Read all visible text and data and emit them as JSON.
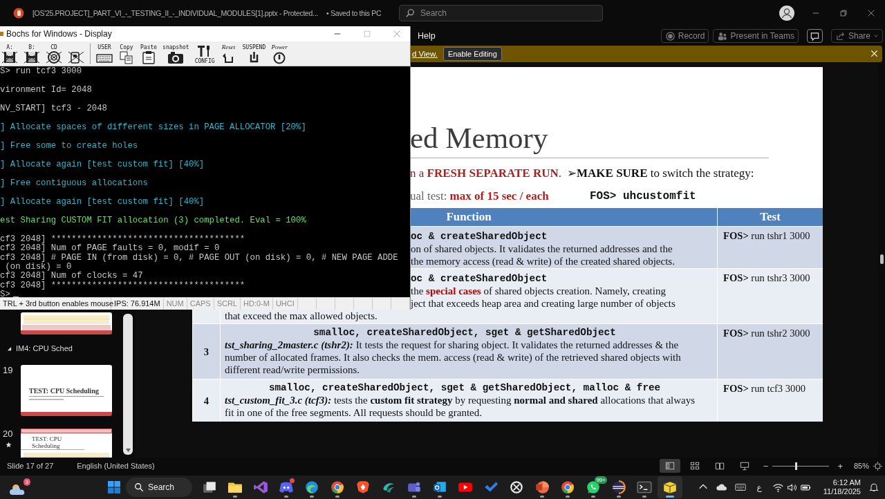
{
  "app_window": {
    "title": "[OS'25.PROJECT]_PART_VI_-_TESTING_II_-_INDIVIDUAL_MODULES[1].pptx  -  Protected...",
    "save_status": "• Saved to this PC",
    "search": {
      "placeholder": "Search"
    }
  },
  "ribbon": {
    "tabs": [
      {
        "label": "Help",
        "selected": false
      }
    ],
    "buttons": [
      {
        "kind": "record",
        "label": "Record"
      },
      {
        "kind": "teams",
        "label": "Present in Teams"
      },
      {
        "kind": "comments"
      },
      {
        "kind": "share",
        "label": "Share"
      }
    ]
  },
  "message_bar": {
    "link": "d View.",
    "button": "Enable Editing"
  },
  "thumbnails": [
    {
      "kind": "table_slide"
    },
    {
      "kind": "section",
      "label": "IM4: CPU Sched",
      "expanded": true
    },
    {
      "kind": "title_slide",
      "number": "19",
      "title": "TEST: CPU Scheduling",
      "animated": false
    },
    {
      "kind": "table_slide",
      "number": "20",
      "title": "TEST: CPU Scheduling",
      "animated": true
    }
  ],
  "slide": {
    "title": "ed Memory",
    "notes": [
      {
        "kind": "warning",
        "text": "n a **FRESH SEPARATE RUN**."
      },
      {
        "kind": "plain",
        "text": "➢**MAKE SURE** to switch the strategy:"
      },
      {
        "kind": "limit",
        "text": "ual test: **max of 15 sec / each**"
      },
      {
        "kind": "command",
        "text": "FOS> uhcustomfit"
      }
    ],
    "table": {
      "columns": [
        "Function",
        "Test"
      ],
      "rows": [
        {
          "kind": "partial",
          "function": "oc & createSharedObject",
          "lines": [
            {
              "text": "on of shared objects. It validates the returned addresses and the",
              "cut": true
            },
            {
              "text": "the memory access (read & write) of the created shared objects.",
              "cut": true
            }
          ],
          "test": "**FOS>** run tshr1 3000"
        },
        {
          "kind": "partial",
          "function": "oc & createSharedObject",
          "lines": [
            {
              "text": "the **special cases** of shared objects creation. Namely, creating",
              "cut": true
            },
            {
              "text": "ject that exceeds heap area and creating large number of objects",
              "cut": true
            },
            {
              "text": "that exceed the max allowed objects.",
              "cut": false
            }
          ],
          "test": "**FOS>** run tshr3 3000"
        },
        {
          "kind": "full",
          "number": "3",
          "function": "smalloc, createSharedObject, sget & getSharedObject",
          "file": "tst_sharing_2master.c (tshr2):",
          "text": "It tests the request for sharing object. It validates the returned addresses & the number of allocated frames. It also checks the mem. access (read & write) of the retrieved shared objects with different read/write permissions.",
          "test": "**FOS>** run tshr2 3000"
        },
        {
          "kind": "full",
          "number": "4",
          "function": "smalloc, createSharedObject, sget & getSharedObject, malloc & free",
          "file": "tst_custom_fit_3.c (tcf3):",
          "text": "tests the **custom fit strategy** by requesting **normal and shared** allocations that always fit in one of the free segments. All requests should be granted.",
          "test": "**FOS>** run tcf3 3000"
        }
      ]
    }
  },
  "status_bar": {
    "slide": "Slide 17 of 27",
    "language": "English (United States)",
    "views": [
      {
        "kind": "normal",
        "selected": true
      },
      {
        "kind": "sorter",
        "selected": false
      },
      {
        "kind": "reading",
        "selected": false
      },
      {
        "kind": "show",
        "selected": false
      }
    ],
    "zoom": {
      "minus": "−",
      "plus": "+",
      "level": 0.41,
      "reading": "85%"
    }
  },
  "bochs_window": {
    "title": "Bochs for Windows - Display",
    "toolbar": [
      {
        "kind": "floppy",
        "label": "A:",
        "disabled": true
      },
      {
        "kind": "floppy",
        "label": "B:",
        "disabled": true
      },
      {
        "kind": "cdrom",
        "label": "CD",
        "disabled": true
      },
      {
        "kind": "harddisk",
        "disabled": true
      },
      {
        "kind": "user",
        "label": "USER",
        "disabled": false
      },
      {
        "kind": "copy",
        "label": "Copy",
        "disabled": false
      },
      {
        "kind": "paste",
        "label": "Paste",
        "disabled": false
      },
      {
        "kind": "snapshot",
        "label": "snapshot",
        "disabled": false
      },
      {
        "kind": "config",
        "label": "CONFIG",
        "disabled": false
      },
      {
        "kind": "reset",
        "label": "Reset",
        "disabled": false
      },
      {
        "kind": "suspend",
        "label": "SUSPEND",
        "disabled": false
      },
      {
        "kind": "power",
        "label": "Power",
        "disabled": false
      }
    ],
    "console": [
      {
        "kind": "info",
        "text": "S> run tcf3 3000"
      },
      {
        "kind": "info",
        "text": "vironment Id= 2048"
      },
      {
        "kind": "info",
        "text": "NV_START] tcf3 - 2048"
      },
      {
        "kind": "step",
        "text": "] Allocate spaces of different sizes in PAGE ALLOCATOR [20%]"
      },
      {
        "kind": "step",
        "text": "] Free some to create holes"
      },
      {
        "kind": "step",
        "text": "] Allocate again [test custom fit] [40%]"
      },
      {
        "kind": "step",
        "text": "] Free contiguous allocations"
      },
      {
        "kind": "step",
        "text": "] Allocate again [test custom fit] [40%]"
      },
      {
        "kind": "result",
        "text": "est Sharing CUSTOM FIT allocation (3) completed. Eval = 100%"
      },
      {
        "kind": "log",
        "text": "cf3 2048] **************************************"
      },
      {
        "kind": "log",
        "text": "cf3 2048] Num of PAGE faults = 0, modif = 0"
      },
      {
        "kind": "log",
        "text": "cf3 2048] # PAGE IN (from disk) = 0, # PAGE OUT (on disk) = 0, # NEW PAGE ADDE"
      },
      {
        "kind": "log",
        "text": " (on disk) = 0"
      },
      {
        "kind": "log",
        "text": "cf3 2048] Num of clocks = 47"
      },
      {
        "kind": "log",
        "text": "cf3 2048] **************************************"
      },
      {
        "kind": "prompt",
        "text": "S>"
      }
    ],
    "status": [
      {
        "text": "TRL + 3rd button enables mouse",
        "active": true
      },
      {
        "text": "IPS: 76.914M",
        "active": true
      },
      {
        "text": "NUM",
        "active": false
      },
      {
        "text": "CAPS",
        "active": false
      },
      {
        "text": "SCRL",
        "active": false
      },
      {
        "text": "HD:0-M",
        "active": false
      },
      {
        "text": "UHCI",
        "active": false
      }
    ]
  },
  "taskbar": {
    "weather_badge": "3",
    "search": "Search",
    "apps": [
      {
        "kind": "taskview",
        "running": false
      },
      {
        "kind": "folder",
        "running": true
      },
      {
        "kind": "vs",
        "running": false
      },
      {
        "kind": "discord",
        "running": true,
        "dot": true
      },
      {
        "kind": "edge",
        "running": true
      },
      {
        "kind": "chrome",
        "running": true
      },
      {
        "kind": "brave",
        "running": false
      },
      {
        "kind": "wave",
        "running": false
      },
      {
        "kind": "teams",
        "running": true
      },
      {
        "kind": "outlook",
        "running": true
      },
      {
        "kind": "youtube",
        "running": false
      },
      {
        "kind": "todo",
        "running": false
      },
      {
        "kind": "chatgpt",
        "running": false
      },
      {
        "kind": "powerpoint",
        "running": true
      },
      {
        "kind": "chrome",
        "running": true
      },
      {
        "kind": "whatsapp",
        "running": true,
        "badge": "99+"
      },
      {
        "kind": "eclipse",
        "running": true
      },
      {
        "kind": "terminal",
        "running": true
      },
      {
        "kind": "box",
        "running": true,
        "selected": true
      }
    ],
    "tray": {
      "language": "ع",
      "time": "6:12 AM",
      "date": "11/18/2025"
    }
  }
}
